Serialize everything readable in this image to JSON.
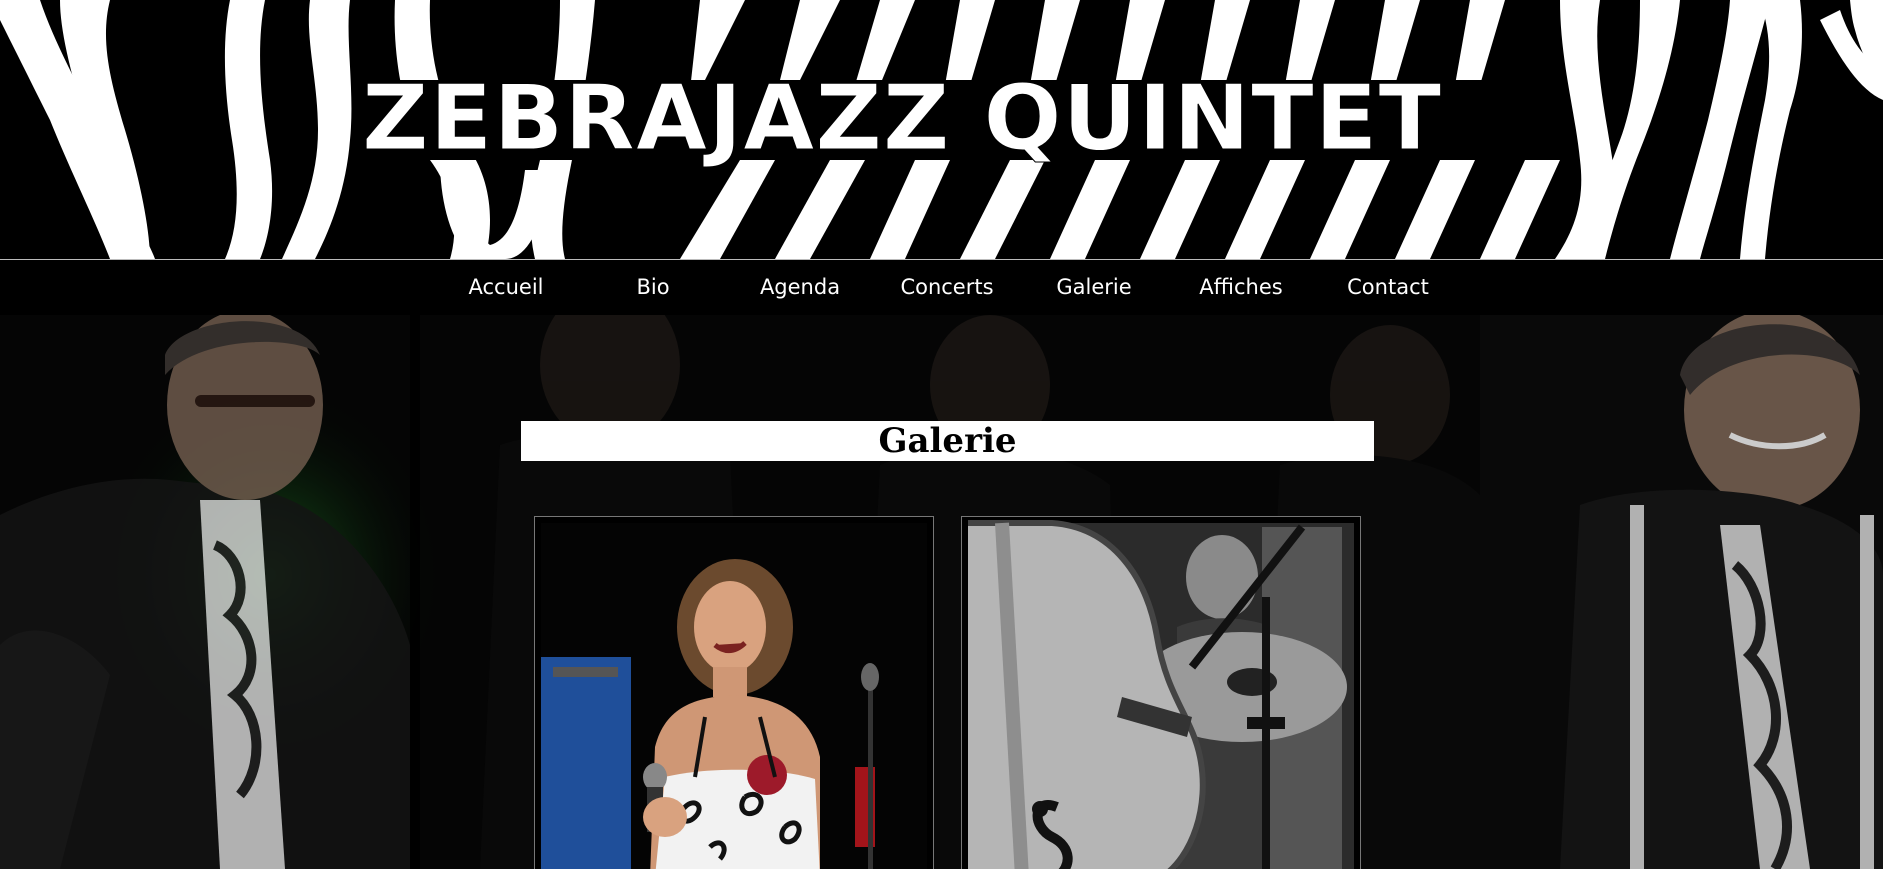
{
  "site": {
    "title": "ZEBRAJAZZ QUINTET"
  },
  "nav": {
    "items": [
      {
        "label": "Accueil"
      },
      {
        "label": "Bio"
      },
      {
        "label": "Agenda"
      },
      {
        "label": "Concerts"
      },
      {
        "label": "Galerie"
      },
      {
        "label": "Affiches"
      },
      {
        "label": "Contact"
      }
    ]
  },
  "page": {
    "heading": "Galerie"
  },
  "gallery": {
    "photos": [
      {
        "subject": "singer-photo"
      },
      {
        "subject": "double-bass-photo"
      }
    ]
  },
  "colors": {
    "background": "#000000",
    "text": "#ffffff",
    "heading_box": "#ffffff",
    "accent_green": "#1f7a2a"
  }
}
